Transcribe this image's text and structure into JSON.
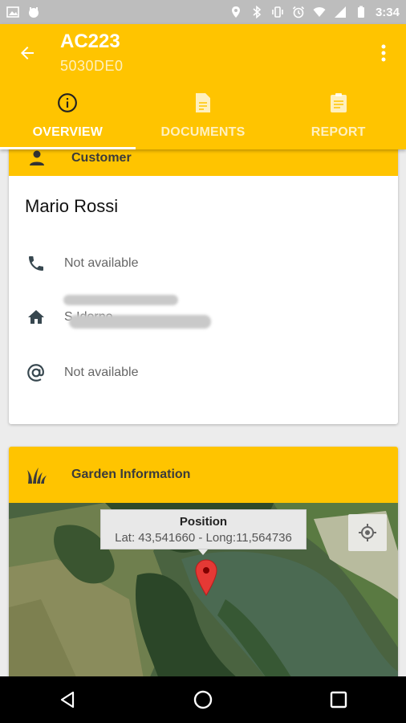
{
  "status_bar": {
    "time": "3:34"
  },
  "app_bar": {
    "title": "AC223",
    "subtitle": "5030DE0"
  },
  "tabs": [
    {
      "label": "OVERVIEW",
      "icon": "info-icon",
      "active": true
    },
    {
      "label": "DOCUMENTS",
      "icon": "document-icon",
      "active": false
    },
    {
      "label": "REPORT",
      "icon": "clipboard-icon",
      "active": false
    }
  ],
  "customer": {
    "header": "Customer",
    "name": "Mario Rossi",
    "phone": "Not available",
    "address_partial": "S                    Idorno",
    "email": "Not available"
  },
  "garden": {
    "header": "Garden Information",
    "map_popup_title": "Position",
    "map_popup_text": "Lat: 43,541660 - Long:11,564736"
  },
  "colors": {
    "accent": "#FFC400",
    "nav": "#000000"
  }
}
